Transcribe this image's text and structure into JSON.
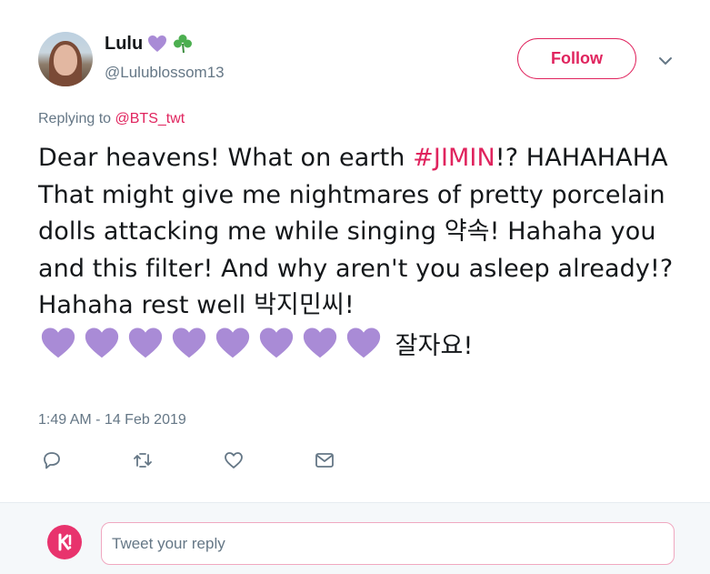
{
  "author": {
    "display_name": "Lulu",
    "name_emojis": [
      "purple-heart",
      "shamrock"
    ],
    "handle": "@Lulublossom13"
  },
  "follow_button": {
    "label": "Follow"
  },
  "more_menu": {
    "icon": "chevron-down-icon"
  },
  "replying": {
    "prefix": "Replying to ",
    "mention": "@BTS_twt"
  },
  "tweet": {
    "text_part1": "Dear heavens! What on earth ",
    "hashtag": "#JIMIN",
    "text_part2": "!? HAHAHAHA That might give me nightmares of pretty porcelain dolls attacking me while singing 약속! Hahaha you and this filter! And why aren't you asleep already!? Hahaha rest well 박지민씨! ",
    "heart_count": 8,
    "heart_color": "#a98bd6",
    "text_part3": " 잘자요!"
  },
  "timestamp": "1:49 AM - 14 Feb 2019",
  "actions": [
    {
      "name": "reply",
      "icon": "reply-icon"
    },
    {
      "name": "retweet",
      "icon": "retweet-icon"
    },
    {
      "name": "like",
      "icon": "heart-icon"
    },
    {
      "name": "message",
      "icon": "envelope-icon"
    }
  ],
  "reply_box": {
    "placeholder": "Tweet your reply"
  },
  "colors": {
    "accent": "#e0245e",
    "muted": "#657786",
    "text": "#14171a",
    "reply_bg": "#f5f8fa"
  }
}
